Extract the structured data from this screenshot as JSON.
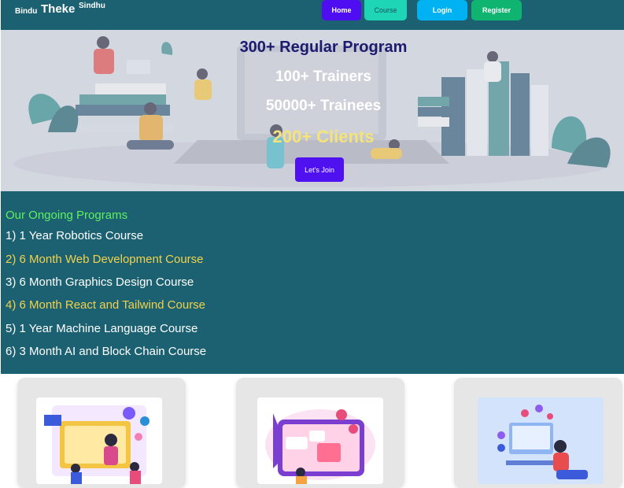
{
  "brand": {
    "prefix": "Bindu",
    "main": "Theke",
    "suffix": "Sindhu"
  },
  "nav": {
    "home": "Home",
    "course": "Course",
    "login": "Login",
    "register": "Register"
  },
  "hero": {
    "line1": "300+ Regular Program",
    "line2": "100+ Trainers",
    "line3": "50000+ Trainees",
    "line4": "200+ Clients",
    "join_label": "Let's Join"
  },
  "programs": {
    "title": "Our Ongoing Programs",
    "items": [
      "1) 1 Year Robotics Course",
      "2) 6 Month Web Development Course",
      "3) 6 Month Graphics Design Course",
      "4) 6 Month React and Tailwind Course",
      "5) 1 Year Machine Language Course",
      "6) 3 Month AI and Block Chain Course"
    ]
  },
  "colors": {
    "primary_teal": "#1b6172",
    "accent_yellow": "#f1d24a",
    "accent_green": "#5ef05e",
    "btn_purple": "#4f0ef2"
  },
  "cards": [
    {
      "icon": "online-teaching-illustration"
    },
    {
      "icon": "web-development-illustration"
    },
    {
      "icon": "programmer-desk-illustration"
    }
  ]
}
